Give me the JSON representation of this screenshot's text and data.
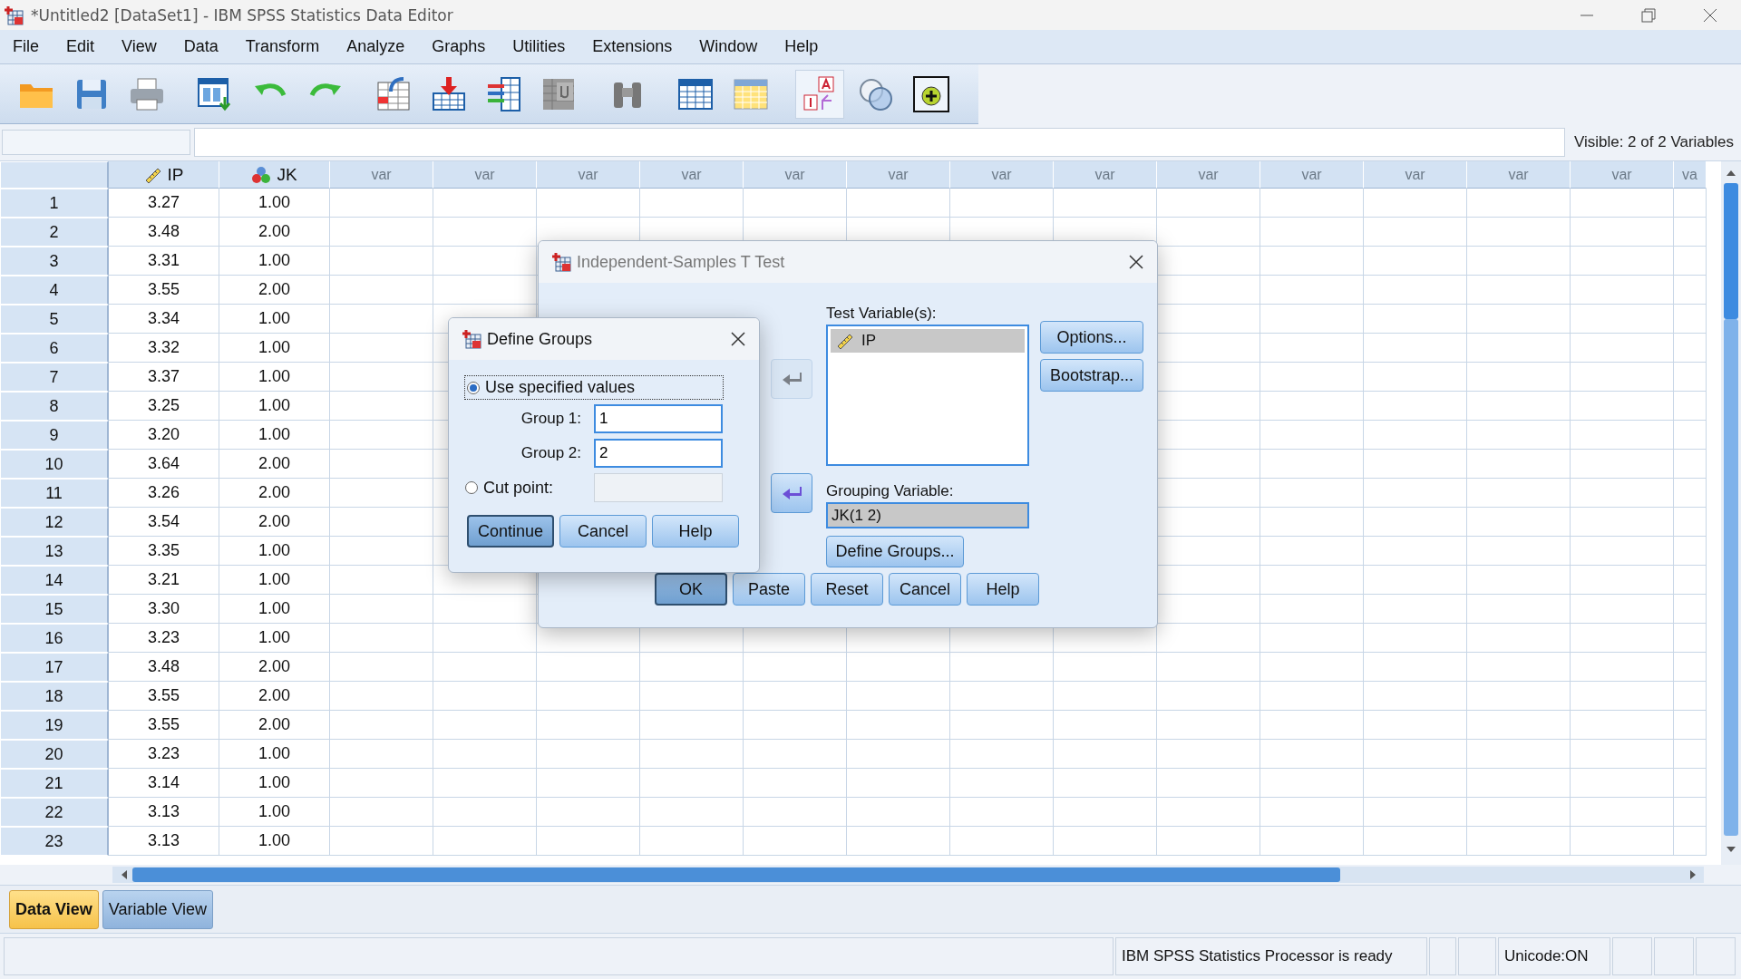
{
  "window": {
    "title": "*Untitled2 [DataSet1] - IBM SPSS Statistics Data Editor"
  },
  "menu": [
    "File",
    "Edit",
    "View",
    "Data",
    "Transform",
    "Analyze",
    "Graphs",
    "Utilities",
    "Extensions",
    "Window",
    "Help"
  ],
  "visible_label": "Visible: 2 of 2 Variables",
  "grid": {
    "columns": [
      {
        "label": "IP",
        "kind": "scale"
      },
      {
        "label": "JK",
        "kind": "nominal"
      },
      {
        "label": "var",
        "kind": "empty"
      },
      {
        "label": "var",
        "kind": "empty"
      },
      {
        "label": "var",
        "kind": "empty"
      },
      {
        "label": "var",
        "kind": "empty"
      },
      {
        "label": "var",
        "kind": "empty"
      },
      {
        "label": "var",
        "kind": "empty"
      },
      {
        "label": "var",
        "kind": "empty"
      },
      {
        "label": "var",
        "kind": "empty"
      },
      {
        "label": "var",
        "kind": "empty"
      },
      {
        "label": "var",
        "kind": "empty"
      },
      {
        "label": "var",
        "kind": "empty"
      },
      {
        "label": "var",
        "kind": "empty"
      },
      {
        "label": "var",
        "kind": "empty"
      },
      {
        "label": "va",
        "kind": "cut"
      }
    ],
    "rows": [
      {
        "number": "1",
        "cells": [
          "3.27",
          "1.00"
        ]
      },
      {
        "number": "2",
        "cells": [
          "3.48",
          "2.00"
        ]
      },
      {
        "number": "3",
        "cells": [
          "3.31",
          "1.00"
        ]
      },
      {
        "number": "4",
        "cells": [
          "3.55",
          "2.00"
        ]
      },
      {
        "number": "5",
        "cells": [
          "3.34",
          "1.00"
        ]
      },
      {
        "number": "6",
        "cells": [
          "3.32",
          "1.00"
        ]
      },
      {
        "number": "7",
        "cells": [
          "3.37",
          "1.00"
        ]
      },
      {
        "number": "8",
        "cells": [
          "3.25",
          "1.00"
        ]
      },
      {
        "number": "9",
        "cells": [
          "3.20",
          "1.00"
        ]
      },
      {
        "number": "10",
        "cells": [
          "3.64",
          "2.00"
        ]
      },
      {
        "number": "11",
        "cells": [
          "3.26",
          "2.00"
        ]
      },
      {
        "number": "12",
        "cells": [
          "3.54",
          "2.00"
        ]
      },
      {
        "number": "13",
        "cells": [
          "3.35",
          "1.00"
        ]
      },
      {
        "number": "14",
        "cells": [
          "3.21",
          "1.00"
        ]
      },
      {
        "number": "15",
        "cells": [
          "3.30",
          "1.00"
        ]
      },
      {
        "number": "16",
        "cells": [
          "3.23",
          "1.00"
        ]
      },
      {
        "number": "17",
        "cells": [
          "3.48",
          "2.00"
        ]
      },
      {
        "number": "18",
        "cells": [
          "3.55",
          "2.00"
        ]
      },
      {
        "number": "19",
        "cells": [
          "3.55",
          "2.00"
        ]
      },
      {
        "number": "20",
        "cells": [
          "3.23",
          "1.00"
        ]
      },
      {
        "number": "21",
        "cells": [
          "3.14",
          "1.00"
        ]
      },
      {
        "number": "22",
        "cells": [
          "3.13",
          "1.00"
        ]
      },
      {
        "number": "23",
        "cells": [
          "3.13",
          "1.00"
        ]
      }
    ]
  },
  "tabs": [
    {
      "label": "Data View",
      "selected": true
    },
    {
      "label": "Variable View",
      "selected": false
    }
  ],
  "status_bar": [
    "IBM SPSS Statistics Processor is ready",
    "Unicode:ON"
  ],
  "t_test_dialog": {
    "title": "Independent-Samples T Test",
    "test_variables_label": "Test Variable(s):",
    "test_variables": [
      {
        "name": "IP",
        "selected": true
      }
    ],
    "grouping_label": "Grouping Variable:",
    "grouping_value": "JK(1 2)",
    "move_buttons": [
      {
        "disabled": true
      },
      {
        "disabled": false
      }
    ],
    "side_buttons": [
      "Options...",
      "Bootstrap..."
    ],
    "define_groups_button": "Define Groups...",
    "buttons": [
      {
        "label": "OK",
        "default": true
      },
      {
        "label": "Paste",
        "default": false
      },
      {
        "label": "Reset",
        "default": false
      },
      {
        "label": "Cancel",
        "default": false
      },
      {
        "label": "Help",
        "default": false
      }
    ]
  },
  "define_groups_dialog": {
    "title": "Define Groups",
    "options": [
      {
        "label": "Use specified values",
        "selected": true
      },
      {
        "label": "Cut point:",
        "selected": false
      }
    ],
    "group_fields": [
      {
        "label": "Group 1:",
        "value": "1"
      },
      {
        "label": "Group 2:",
        "value": "2"
      }
    ],
    "cut_point": {
      "disabled": true
    },
    "buttons": [
      {
        "label": "Continue",
        "default": true
      },
      {
        "label": "Cancel",
        "default": false
      },
      {
        "label": "Help",
        "default": false
      }
    ]
  }
}
